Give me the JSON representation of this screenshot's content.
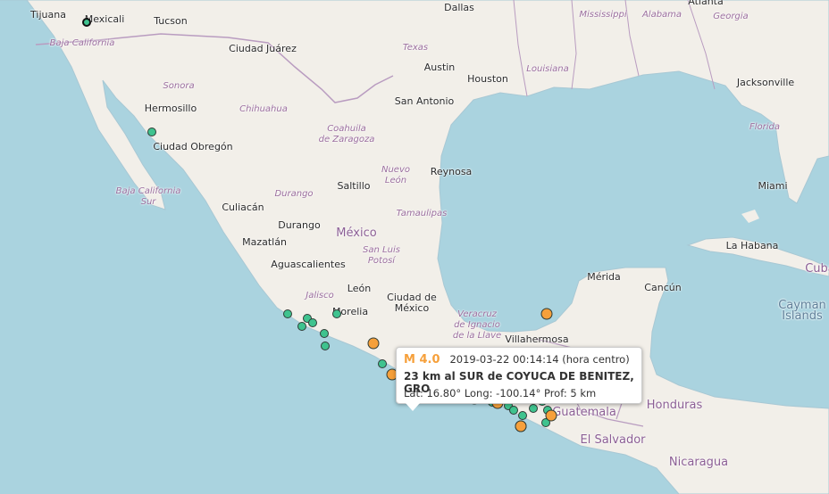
{
  "map": {
    "colors": {
      "water": "#aad3df",
      "land": "#f2efe9",
      "border": "#b99cc0",
      "quake_small": "#3fc38f",
      "quake_large": "#f6a03b"
    },
    "labels": [
      {
        "text": "Tijuana",
        "kind": "city"
      },
      {
        "text": "Mexicali",
        "kind": "city"
      },
      {
        "text": "Tucson",
        "kind": "city"
      },
      {
        "text": "Dallas",
        "kind": "city"
      },
      {
        "text": "Mississippi",
        "kind": "state"
      },
      {
        "text": "Alabama",
        "kind": "state"
      },
      {
        "text": "Georgia",
        "kind": "state"
      },
      {
        "text": "Atlanta",
        "kind": "city"
      },
      {
        "text": "Baja California",
        "kind": "state"
      },
      {
        "text": "Ciudad Juárez",
        "kind": "city"
      },
      {
        "text": "Texas",
        "kind": "state"
      },
      {
        "text": "Austin",
        "kind": "city"
      },
      {
        "text": "Houston",
        "kind": "city"
      },
      {
        "text": "Louisiana",
        "kind": "state"
      },
      {
        "text": "Sonora",
        "kind": "state"
      },
      {
        "text": "Hermosillo",
        "kind": "city"
      },
      {
        "text": "San Antonio",
        "kind": "city"
      },
      {
        "text": "Jacksonville",
        "kind": "city"
      },
      {
        "text": "Chihuahua",
        "kind": "state"
      },
      {
        "text": "Coahuila de Zaragoza",
        "kind": "state"
      },
      {
        "text": "Florida",
        "kind": "state"
      },
      {
        "text": "Ciudad Obregón",
        "kind": "city"
      },
      {
        "text": "Reynosa",
        "kind": "city"
      },
      {
        "text": "Nuevo León",
        "kind": "state"
      },
      {
        "text": "Saltillo",
        "kind": "city"
      },
      {
        "text": "Miami",
        "kind": "city"
      },
      {
        "text": "Baja California Sur",
        "kind": "state"
      },
      {
        "text": "Durango",
        "kind": "state"
      },
      {
        "text": "Culiacán",
        "kind": "city"
      },
      {
        "text": "Tamaulipas",
        "kind": "state"
      },
      {
        "text": "Durango",
        "kind": "city"
      },
      {
        "text": "México",
        "kind": "country"
      },
      {
        "text": "Mazatlán",
        "kind": "city"
      },
      {
        "text": "La Habana",
        "kind": "city"
      },
      {
        "text": "San Luis Potosí",
        "kind": "state"
      },
      {
        "text": "Aguascalientes",
        "kind": "city"
      },
      {
        "text": "Mérida",
        "kind": "city"
      },
      {
        "text": "Cuba",
        "kind": "country"
      },
      {
        "text": "Jalisco",
        "kind": "state"
      },
      {
        "text": "León",
        "kind": "city"
      },
      {
        "text": "Cancún",
        "kind": "city"
      },
      {
        "text": "Ciudad de México",
        "kind": "city"
      },
      {
        "text": "Cayman Islands",
        "kind": "sea"
      },
      {
        "text": "Morelia",
        "kind": "city"
      },
      {
        "text": "Veracruz de Ignacio de la Llave",
        "kind": "state"
      },
      {
        "text": "Villahermosa",
        "kind": "city"
      },
      {
        "text": "Honduras",
        "kind": "country"
      },
      {
        "text": "Guatemala",
        "kind": "country"
      },
      {
        "text": "El Salvador",
        "kind": "country"
      },
      {
        "text": "Nicaragua",
        "kind": "country"
      }
    ]
  },
  "earthquakes": [
    {
      "mag": "small"
    },
    {
      "mag": "small"
    },
    {
      "mag": "small"
    },
    {
      "mag": "small"
    },
    {
      "mag": "small"
    },
    {
      "mag": "small"
    },
    {
      "mag": "small"
    },
    {
      "mag": "small"
    },
    {
      "mag": "small"
    },
    {
      "mag": "small"
    },
    {
      "mag": "large"
    },
    {
      "mag": "large"
    },
    {
      "mag": "small"
    },
    {
      "mag": "large"
    },
    {
      "mag": "small"
    },
    {
      "mag": "small"
    },
    {
      "mag": "large"
    },
    {
      "mag": "small"
    },
    {
      "mag": "small"
    },
    {
      "mag": "small"
    },
    {
      "mag": "small"
    },
    {
      "mag": "large"
    },
    {
      "mag": "small"
    },
    {
      "mag": "small"
    },
    {
      "mag": "large"
    },
    {
      "mag": "small"
    },
    {
      "mag": "large"
    },
    {
      "mag": "large"
    }
  ],
  "popup": {
    "magnitude": "M 4.0",
    "datetime": "2019-03-22   00:14:14 (hora centro)",
    "location": "23 km al SUR de COYUCA DE BENITEZ, GRO",
    "coords": "Lat: 16.80°   Long: -100.14°   Prof: 5 km"
  }
}
